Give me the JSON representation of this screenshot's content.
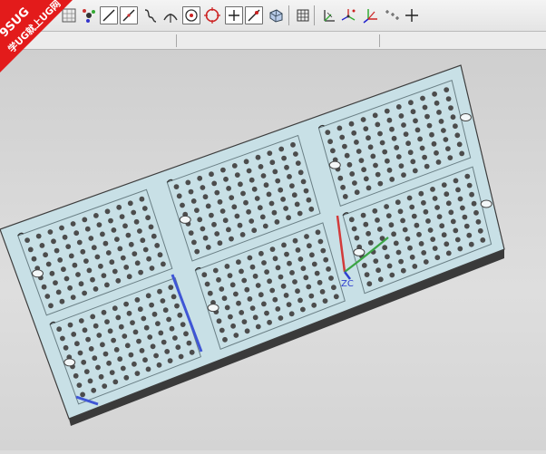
{
  "logo": {
    "brand": "9SUG",
    "slogan": "学UG就上UG网",
    "color": "#e31b1b"
  },
  "toolbar": {
    "icons": [
      "snap-grid-icon",
      "point-dialog-icon",
      "line-icon",
      "spline-icon",
      "curve-icon",
      "arc-icon",
      "point-on-curve-icon",
      "circle-icon",
      "plus-point-icon",
      "line-tangent-icon",
      "shade-icon",
      "matrix-icon",
      "csys-icon",
      "datum-csys-icon",
      "axes-icon",
      "point-set-icon",
      "crosshair-icon"
    ]
  },
  "viewport": {
    "model": "perforated-plate",
    "csys_label": "ZC",
    "colors": {
      "plate": "#c8e0e6",
      "edge": "#3d3d3d",
      "hole": "#4c4c4c",
      "highlight": "#3f56d6",
      "axis_x": "#d23b3b",
      "axis_y": "#3ba545",
      "axis_z": "#2f3fcf"
    }
  }
}
